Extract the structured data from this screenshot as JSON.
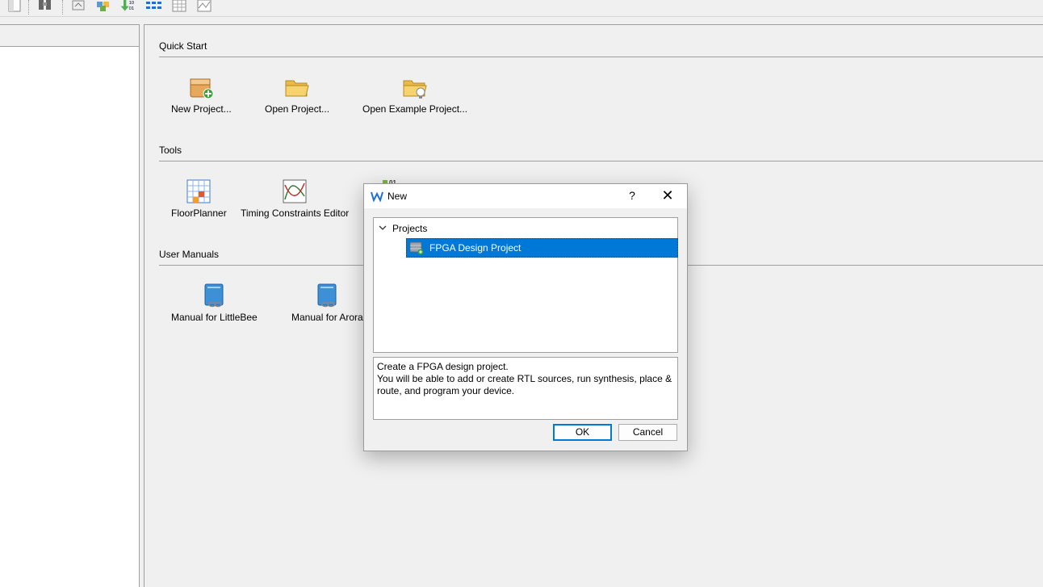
{
  "toolbar": {
    "icons": [
      "new-file-icon",
      "find-icon",
      "process-icon",
      "cube-icon",
      "download-binary-icon",
      "list-icon",
      "grid-icon",
      "chart-icon"
    ]
  },
  "quick_start": {
    "title": "Quick Start",
    "items": [
      {
        "label": "New Project...",
        "icon": "new-project-icon"
      },
      {
        "label": "Open Project...",
        "icon": "open-folder-icon"
      },
      {
        "label": "Open Example Project...",
        "icon": "example-folder-icon"
      }
    ]
  },
  "tools": {
    "title": "Tools",
    "items": [
      {
        "label": "FloorPlanner",
        "icon": "floorplanner-icon"
      },
      {
        "label": "Timing Constraints Editor",
        "icon": "timing-icon"
      }
    ]
  },
  "manuals": {
    "title": "User Manuals",
    "items": [
      {
        "label": "Manual for LittleBee",
        "icon": "manual-icon"
      },
      {
        "label": "Manual for Arora",
        "icon": "manual-icon"
      }
    ]
  },
  "dialog": {
    "title": "New",
    "help": "?",
    "close": "✕",
    "tree": {
      "root": "Projects",
      "child": "FPGA Design Project"
    },
    "description_line1": "Create a FPGA design project.",
    "description_line2": "You will be able to add or create RTL sources, run synthesis, place & route, and program your device.",
    "ok": "OK",
    "cancel": "Cancel"
  },
  "colors": {
    "selection": "#0078d7",
    "background": "#f0f0f0"
  }
}
